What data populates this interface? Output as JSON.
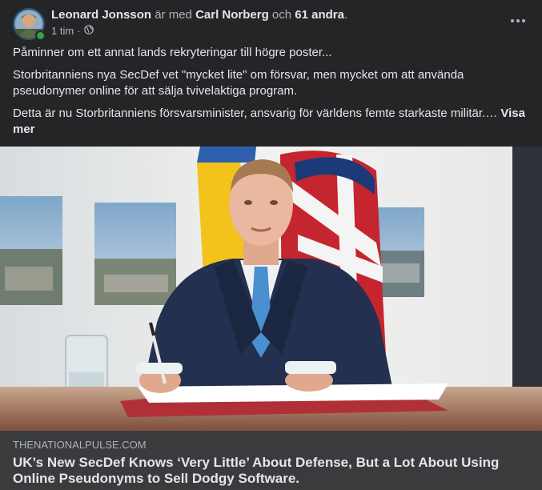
{
  "post": {
    "author": "Leonard Jonsson",
    "with_text": "är med",
    "tagged": "Carl Norberg",
    "and_text": "och",
    "others": "61 andra",
    "period": ".",
    "time": "1 tim",
    "separator": "·",
    "privacy_icon": "globe-icon",
    "paragraphs": [
      "Påminner om ett annat lands rekryteringar till högre poster...",
      "Storbritanniens nya SecDef vet \"mycket lite\" om försvar, men mycket om att använda pseudonymer online för att sälja tvivelaktiga program.",
      "Detta är nu Storbritanniens försvarsminister, ansvarig för världens femte starkaste militär.… "
    ],
    "see_more": "Visa mer"
  },
  "link": {
    "domain": "THENATIONALPULSE.COM",
    "title": "UK’s New SecDef Knows ‘Very Little’ About Defense, But a Lot About Using Online Pseudonyms to Sell Dodgy Software."
  },
  "colors": {
    "background": "#242526",
    "link_box": "#3a3b3c",
    "text_primary": "#e4e6eb",
    "text_secondary": "#b0b3b8",
    "online": "#31a24c"
  }
}
